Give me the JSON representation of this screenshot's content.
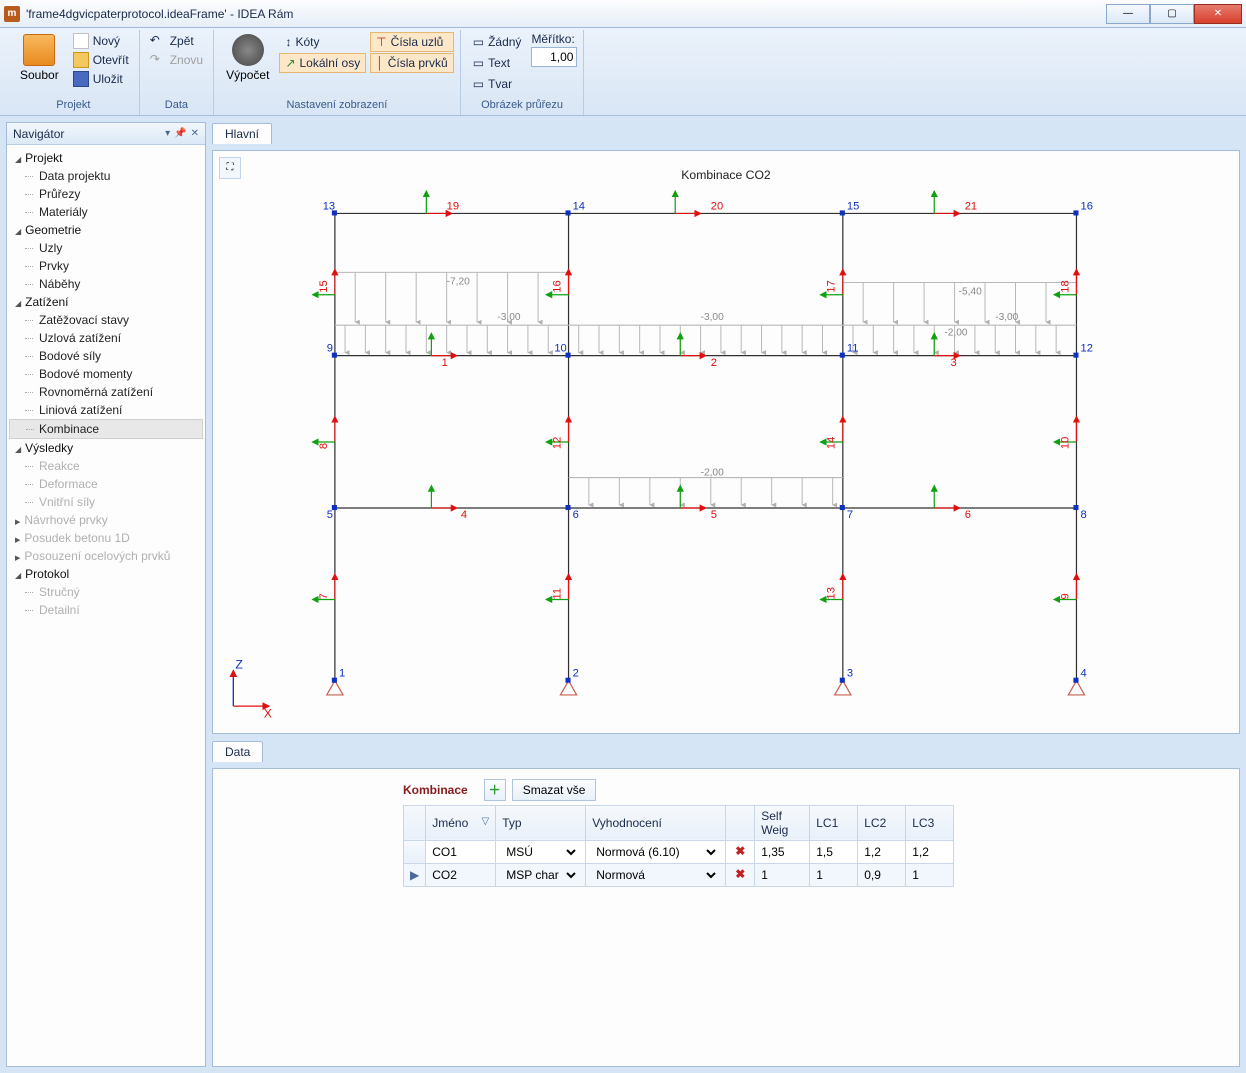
{
  "window": {
    "title": "'frame4dgvicpaterprotocol.ideaFrame' - IDEA Rám"
  },
  "ribbon": {
    "soubor_big": "Soubor",
    "group_projekt": "Projekt",
    "novy": "Nový",
    "otevrit": "Otevřít",
    "ulozit": "Uložit",
    "group_data": "Data",
    "zpet": "Zpět",
    "znovu": "Znovu",
    "vypocet": "Výpočet",
    "group_nastaveni": "Nastavení zobrazení",
    "koty": "Kóty",
    "lokalni": "Lokální osy",
    "cisla_uzlu": "Čísla uzlů",
    "cisla_prvku": "Čísla prvků",
    "group_obrazek": "Obrázek průřezu",
    "zadny": "Žádný",
    "text": "Text",
    "tvar": "Tvar",
    "meritko": "Měřítko:",
    "meritko_val": "1,00"
  },
  "nav": {
    "title": "Navigátor",
    "projekt": "Projekt",
    "data_projektu": "Data projektu",
    "prurezy": "Průřezy",
    "materialy": "Materiály",
    "geometrie": "Geometrie",
    "uzly": "Uzly",
    "prvky": "Prvky",
    "nabehy": "Náběhy",
    "zatizeni": "Zatížení",
    "zs": "Zatěžovací stavy",
    "uz": "Uzlová zatížení",
    "bs": "Bodové síly",
    "bm": "Bodové momenty",
    "rz": "Rovnoměrná zatížení",
    "lz": "Liniová zatížení",
    "komb": "Kombinace",
    "vysledky": "Výsledky",
    "reakce": "Reakce",
    "deformace": "Deformace",
    "vs": "Vnitřní síly",
    "navrh": "Návrhové prvky",
    "posudek": "Posudek betonu 1D",
    "posouzeni": "Posouzení ocelových prvků",
    "protokol": "Protokol",
    "strucny": "Stručný",
    "detailni": "Detailní"
  },
  "tabs": {
    "hlavni": "Hlavní",
    "data": "Data"
  },
  "viewport": {
    "title": "Kombinace CO2",
    "axes": {
      "z": "Z",
      "x": "X"
    },
    "nodes": {
      "1": "1",
      "2": "2",
      "3": "3",
      "4": "4",
      "5": "5",
      "6": "6",
      "7": "7",
      "8": "8",
      "9": "9",
      "10": "10",
      "11": "11",
      "12": "12",
      "13": "13",
      "14": "14",
      "15": "15",
      "16": "16"
    },
    "elems": {
      "1": "1",
      "2": "2",
      "3": "3",
      "4": "4",
      "5": "5",
      "6": "6",
      "7": "7",
      "8": "8",
      "9": "9",
      "10": "10",
      "11": "11",
      "12": "12",
      "13": "13",
      "14": "14",
      "15": "15",
      "16": "16",
      "17": "17",
      "18": "18",
      "19": "19",
      "20": "20",
      "21": "21"
    },
    "loads": {
      "a": "-7,20",
      "b": "-3,00",
      "c": "-3,00",
      "c2": "-3,00",
      "d": "-5,40",
      "e": "-2,00",
      "d2": "-2,00"
    }
  },
  "datapanel": {
    "title": "Kombinace",
    "smazat": "Smazat vše",
    "cols": {
      "jmeno": "Jméno",
      "typ": "Typ",
      "vyhod": "Vyhodnocení",
      "sw": "Self Weig",
      "lc1": "LC1",
      "lc2": "LC2",
      "lc3": "LC3"
    },
    "rows": [
      {
        "jmeno": "CO1",
        "typ": "MSÚ",
        "vyhod": "Normová (6.10)",
        "sw": "1,35",
        "lc1": "1,5",
        "lc2": "1,2",
        "lc3": "1,2"
      },
      {
        "jmeno": "CO2",
        "typ": "MSP char",
        "vyhod": "Normová",
        "sw": "1",
        "lc1": "1",
        "lc2": "0,9",
        "lc3": "1"
      }
    ]
  }
}
